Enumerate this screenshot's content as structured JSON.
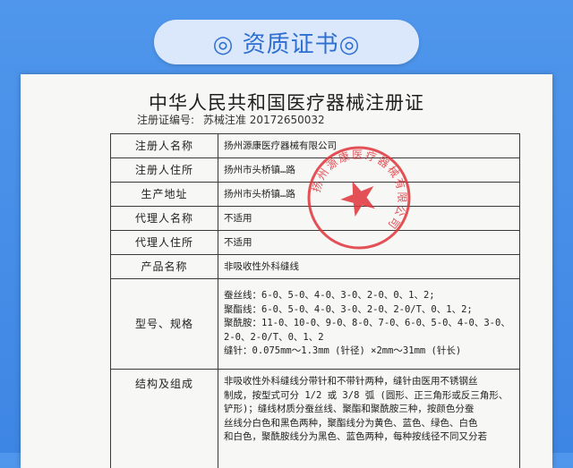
{
  "banner": {
    "title": "◎ 资质证书◎"
  },
  "document": {
    "title": "中华人民共和国医疗器械注册证",
    "reg_label": "注册证编号:",
    "reg_value": "苏械注准 20172650032",
    "rows": [
      {
        "label": "注册人名称",
        "value": "扬州源康医疗器械有限公司"
      },
      {
        "label": "注册人住所",
        "value": "扬州市头桥镇…路"
      },
      {
        "label": "生产地址",
        "value": "扬州市头桥镇…路"
      },
      {
        "label": "代理人名称",
        "value": "不适用"
      },
      {
        "label": "代理人住所",
        "value": "不适用"
      },
      {
        "label": "产品名称",
        "value": "非吸收性外科缝线"
      }
    ],
    "spec": {
      "label": "型号、规格",
      "lines": [
        "蚕丝线：6-0、5-0、4-0、3-0、2-0、0、1、2;",
        "聚酯线：6-0、5-0、4-0、3-0、2-0、2-0/T、0、1、2;",
        "聚酰胺：11-0、10-0、9-0、8-0、7-0、6-0、5-0、4-0、3-0、",
        "2-0、2-0/T、0、1、2",
        "缝针：0.075mm～1.3mm (针径) ×2mm～31mm (针长)"
      ]
    },
    "structure": {
      "label": "结构及组成",
      "lines": [
        "非吸收性外科缝线分带针和不带针两种，缝针由医用不锈钢丝",
        "制成，按型式可分 1/2 或 3/8 弧 (圆形、正三角形或反三角形、",
        "铲形)；缝线材质分蚕丝线、聚酯和聚酰胺三种，按颜色分蚕",
        "丝线分白色和黑色两种，聚酯线分为黄色、蓝色、绿色、白色",
        "和白色，聚酰胺线分为黑色、蓝色两种，每种按线径不同又分若"
      ]
    },
    "stamp": {
      "text": "扬州源康医疗器械有限公司",
      "color": "#e0343a"
    }
  }
}
